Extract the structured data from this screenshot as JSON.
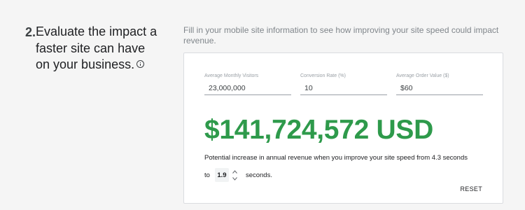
{
  "step": {
    "number": "2.",
    "heading": "Evaluate the impact a faster site can have on your business.",
    "info_icon": "info-icon"
  },
  "intro": "Fill in your mobile site information to see how improving your site speed could impact revenue.",
  "fields": {
    "visitors": {
      "label": "Average Monthly Visitors",
      "value": "23,000,000"
    },
    "conversion": {
      "label": "Conversion Rate (%)",
      "value": "10"
    },
    "order_value": {
      "label": "Average Order Value ($)",
      "value": "$60"
    }
  },
  "result": {
    "amount": "$141,724,572 USD",
    "description": "Potential increase in annual revenue when you improve your site speed from 4.3 seconds"
  },
  "speed": {
    "prefix": "to",
    "value": "1.9",
    "suffix": "seconds.",
    "up_icon": "chevron-up-icon",
    "down_icon": "chevron-down-icon"
  },
  "reset_label": "RESET",
  "colors": {
    "accent_green": "#2e9a4b",
    "background": "#f5f5f5",
    "card": "#ffffff"
  }
}
